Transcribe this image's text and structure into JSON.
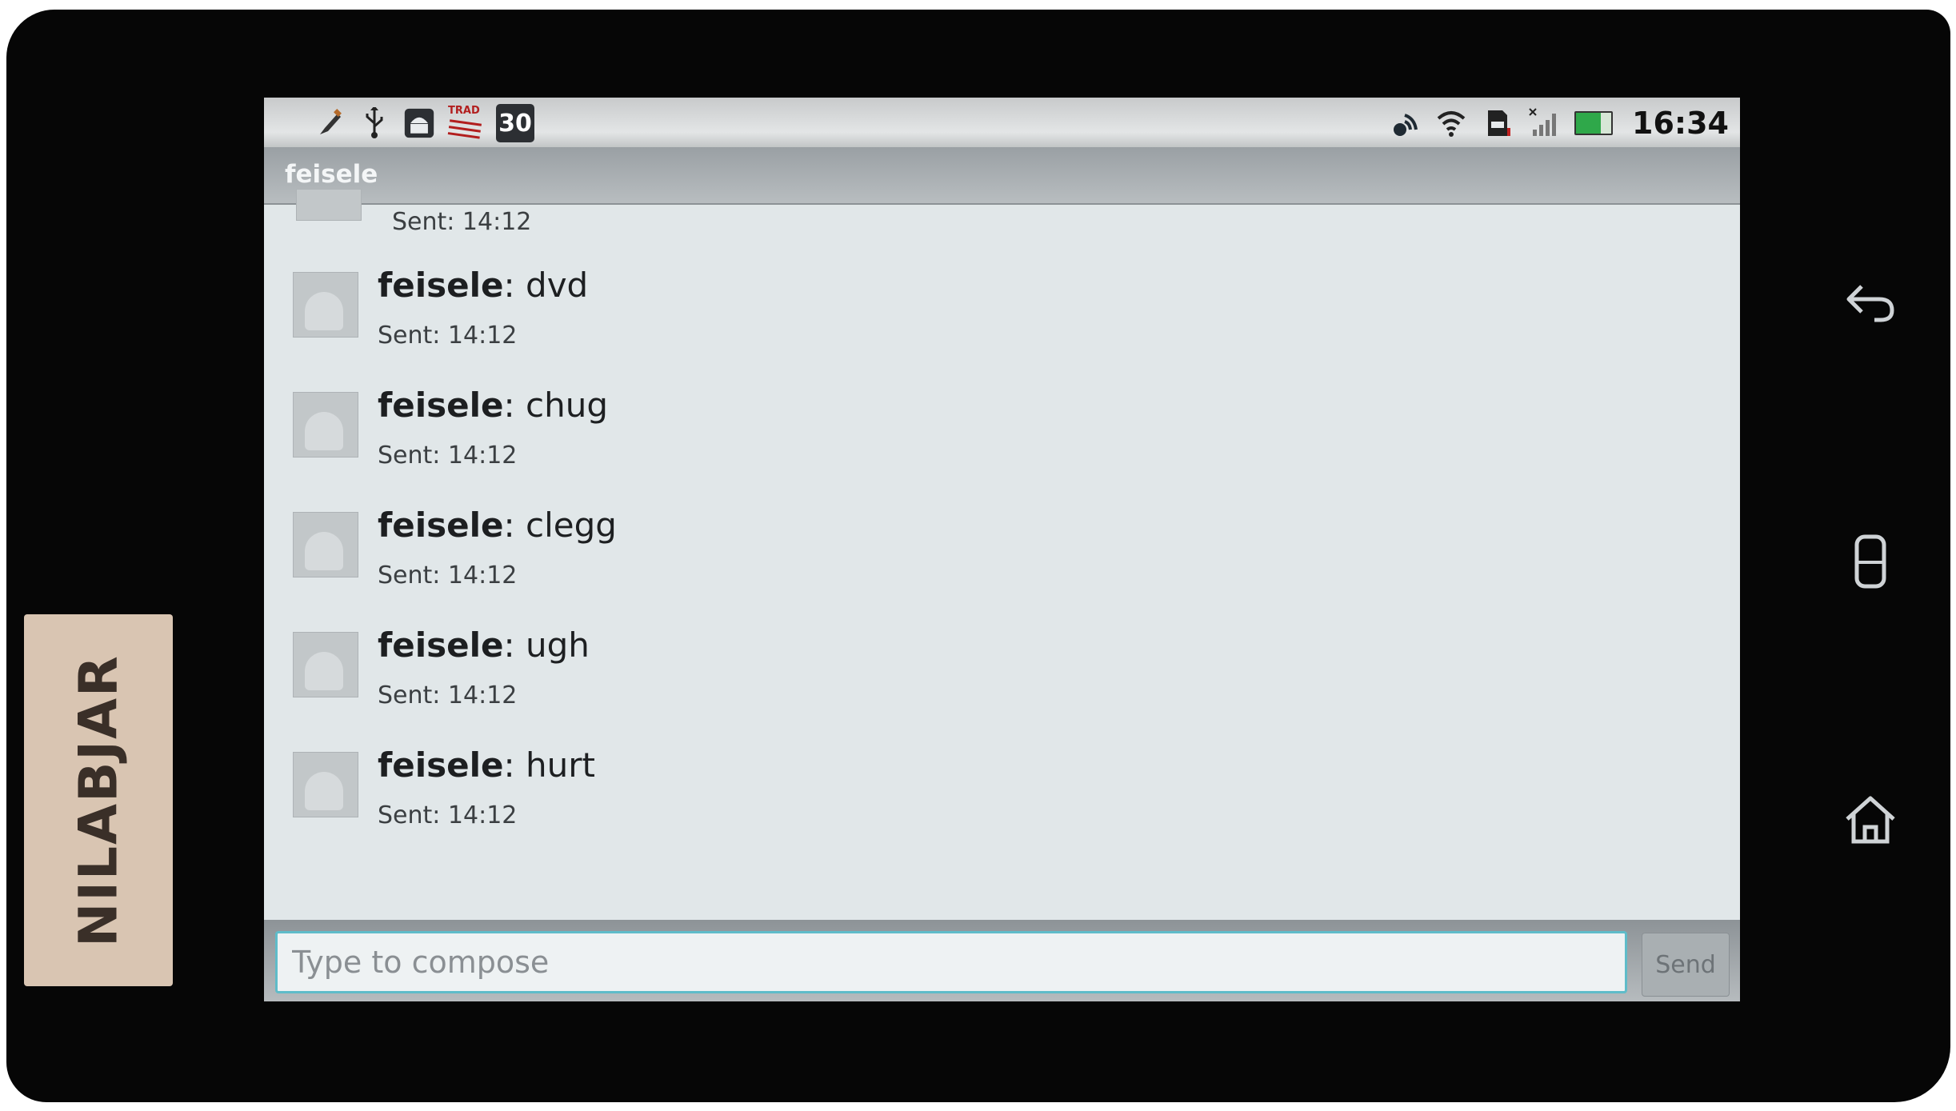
{
  "sticker": {
    "label": "NILABJAR"
  },
  "status_bar": {
    "left_icons": [
      "pen-icon",
      "usb-icon",
      "android-icon",
      "trad-icon"
    ],
    "trad_label": "TRAD",
    "badge_count": "30",
    "right_icons": [
      "sync-icon",
      "wifi-icon",
      "sd-card-icon",
      "signal-icon",
      "battery-icon"
    ],
    "time": "16:34"
  },
  "conversation": {
    "title": "feisele",
    "top_partial_sent": "Sent: 14:12",
    "messages": [
      {
        "sender": "feisele",
        "text": ": dvd",
        "sent": "Sent: 14:12"
      },
      {
        "sender": "feisele",
        "text": ": chug",
        "sent": "Sent: 14:12"
      },
      {
        "sender": "feisele",
        "text": ": clegg",
        "sent": "Sent: 14:12"
      },
      {
        "sender": "feisele",
        "text": ": ugh",
        "sent": "Sent: 14:12"
      },
      {
        "sender": "feisele",
        "text": ":  hurt",
        "sent": "Sent: 14:12"
      }
    ]
  },
  "compose": {
    "placeholder": "Type to compose",
    "value": "",
    "send_label": "Send"
  },
  "hardware_keys": [
    "back-icon",
    "menu-icon",
    "home-icon"
  ]
}
